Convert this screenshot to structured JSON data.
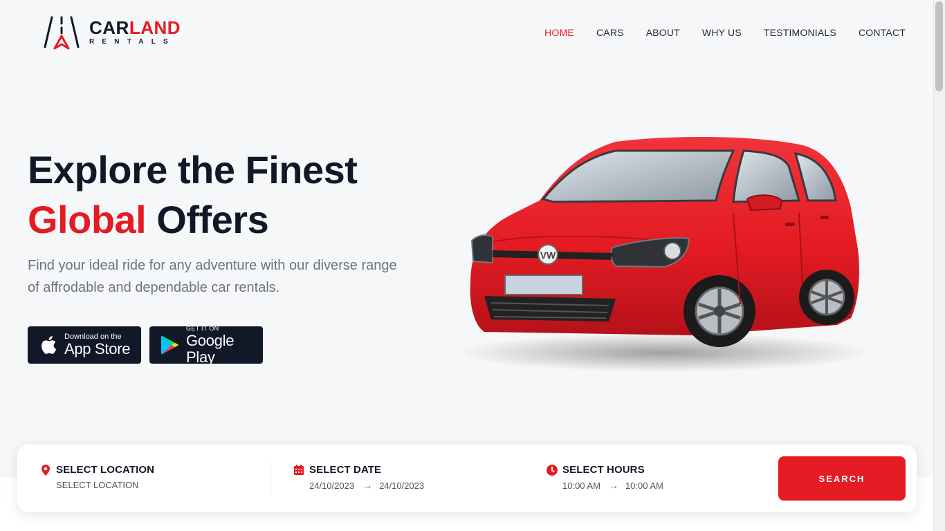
{
  "brand": {
    "name_part1": "CAR",
    "name_part2": "LAND",
    "subtitle": "RENTALS",
    "accent_color": "#e51b23"
  },
  "nav": {
    "items": [
      {
        "label": "HOME",
        "active": true
      },
      {
        "label": "CARS",
        "active": false
      },
      {
        "label": "ABOUT",
        "active": false
      },
      {
        "label": "WHY US",
        "active": false
      },
      {
        "label": "TESTIMONIALS",
        "active": false
      },
      {
        "label": "CONTACT",
        "active": false
      }
    ]
  },
  "hero": {
    "title_line1": "Explore the Finest",
    "title_accent": "Global",
    "title_rest": " Offers",
    "description": "Find your ideal ride for any adventure with our diverse range of affrodable and dependable car rentals.",
    "app_store": {
      "small": "Download on the",
      "big": "App Store",
      "icon": "apple-icon"
    },
    "google_play": {
      "small": "GET IT ON",
      "big": "Google Play",
      "icon": "google-play-icon"
    },
    "car_color": "#e51b23"
  },
  "search": {
    "location": {
      "label": "SELECT LOCATION",
      "value": "SELECT LOCATION",
      "icon": "map-pin-icon"
    },
    "date": {
      "label": "SELECT DATE",
      "from": "24/10/2023",
      "to": "24/10/2023",
      "icon": "calendar-icon"
    },
    "hours": {
      "label": "SELECT HOURS",
      "from": "10:00 AM",
      "to": "10:00 AM",
      "icon": "clock-icon"
    },
    "button_label": "SEARCH"
  }
}
